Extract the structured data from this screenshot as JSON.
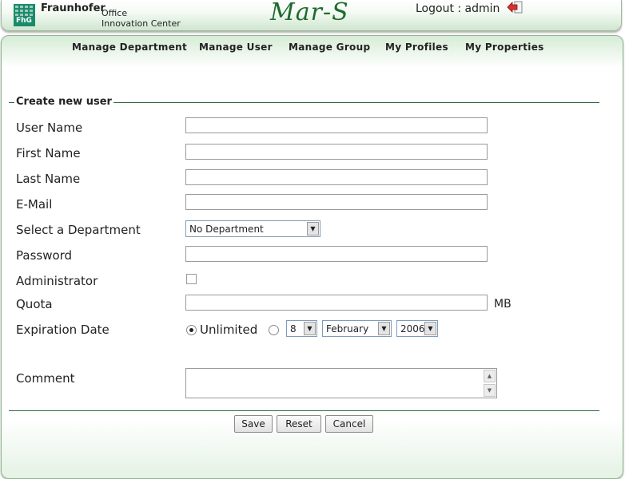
{
  "header": {
    "org_name": "Fraunhofer",
    "org_sub1": "Office",
    "org_sub2": "Innovation Center",
    "logo_text": "FhG",
    "app_title": "Mar-S",
    "logout_text": "Logout : admin",
    "logout_icon": "logout-arrow-icon"
  },
  "nav": [
    {
      "label": "Manage Department"
    },
    {
      "label": "Manage User"
    },
    {
      "label": "Manage Group"
    },
    {
      "label": "My Profiles"
    },
    {
      "label": "My Properties"
    }
  ],
  "form": {
    "legend": "Create new user",
    "labels": {
      "user_name": "User Name",
      "first_name": "First Name",
      "last_name": "Last Name",
      "email": "E-Mail",
      "department": "Select a Department",
      "password": "Password",
      "administrator": "Administrator",
      "quota": "Quota",
      "expiration": "Expiration Date",
      "comment": "Comment"
    },
    "values": {
      "user_name": "",
      "first_name": "",
      "last_name": "",
      "email": "",
      "password": "",
      "quota": "",
      "comment": ""
    },
    "department_selected": "No Department",
    "administrator_checked": false,
    "quota_unit": "MB",
    "expiration": {
      "unlimited_label": "Unlimited",
      "unlimited_selected": true,
      "day": "8",
      "month": "February",
      "year": "2006"
    },
    "buttons": {
      "save": "Save",
      "reset": "Reset",
      "cancel": "Cancel"
    }
  },
  "colors": {
    "brand_green": "#1e6b2e",
    "rule_green": "#2f6b3a",
    "header_gradient_end": "#cfe6cf"
  }
}
